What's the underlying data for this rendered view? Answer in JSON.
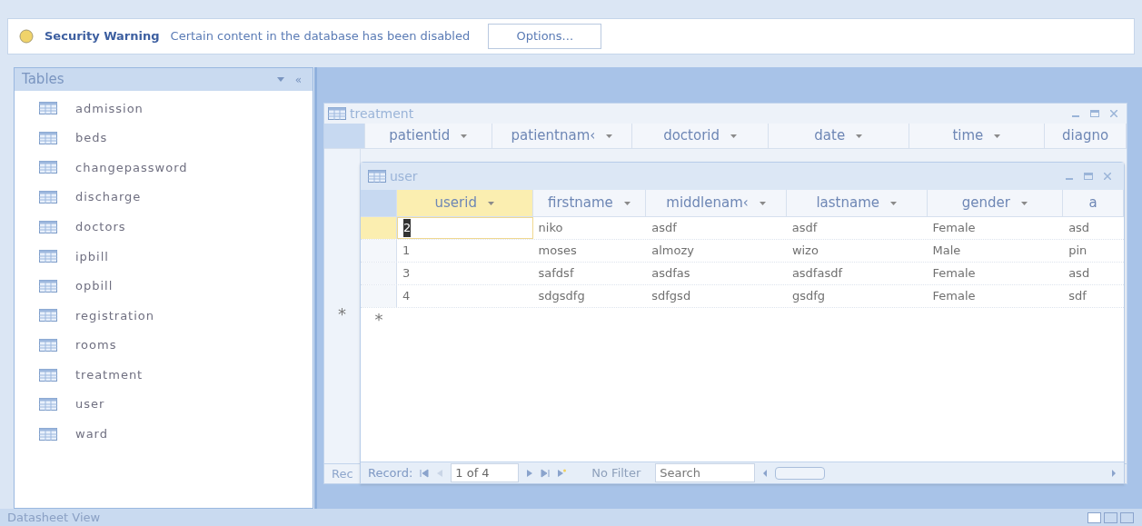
{
  "security_bar": {
    "title": "Security Warning",
    "message": "Certain content in the database has been disabled",
    "button": "Options..."
  },
  "nav_pane": {
    "title": "Tables",
    "collapse": "«",
    "items": [
      {
        "label": "admission"
      },
      {
        "label": "beds"
      },
      {
        "label": "changepassword"
      },
      {
        "label": "discharge"
      },
      {
        "label": "doctors"
      },
      {
        "label": "ipbill"
      },
      {
        "label": "opbill"
      },
      {
        "label": "registration"
      },
      {
        "label": "rooms"
      },
      {
        "label": "treatment"
      },
      {
        "label": "user"
      },
      {
        "label": "ward"
      }
    ]
  },
  "treatment_window": {
    "title": "treatment",
    "columns": [
      "patientid",
      "patientnam‹",
      "doctorid",
      "date",
      "time",
      "diagno"
    ],
    "new_row_marker": "*",
    "record_label": "Rec"
  },
  "user_window": {
    "title": "user",
    "columns": [
      {
        "label": "userid",
        "selected": true
      },
      {
        "label": "firstname",
        "selected": false
      },
      {
        "label": "middlenam‹",
        "selected": false
      },
      {
        "label": "lastname",
        "selected": false
      },
      {
        "label": "gender",
        "selected": false
      },
      {
        "label": "a",
        "selected": false
      }
    ],
    "rows": [
      {
        "selected": true,
        "cells": [
          "2",
          "niko",
          "asdf",
          "asdf",
          "Female",
          "asd"
        ]
      },
      {
        "selected": false,
        "cells": [
          "1",
          "moses",
          "almozy",
          "wizo",
          "Male",
          "pin"
        ]
      },
      {
        "selected": false,
        "cells": [
          "3",
          "safdsf",
          "asdfas",
          "asdfasdf",
          "Female",
          "asd"
        ]
      },
      {
        "selected": false,
        "cells": [
          "4",
          "sdgsdfg",
          "sdfgsd",
          "gsdfg",
          "Female",
          "sdf"
        ]
      }
    ],
    "new_row_marker": "*",
    "record_nav": {
      "label": "Record:",
      "position": "1 of 4",
      "filter": "No Filter",
      "search": "Search"
    }
  },
  "status_bar": {
    "text": "Datasheet View"
  }
}
